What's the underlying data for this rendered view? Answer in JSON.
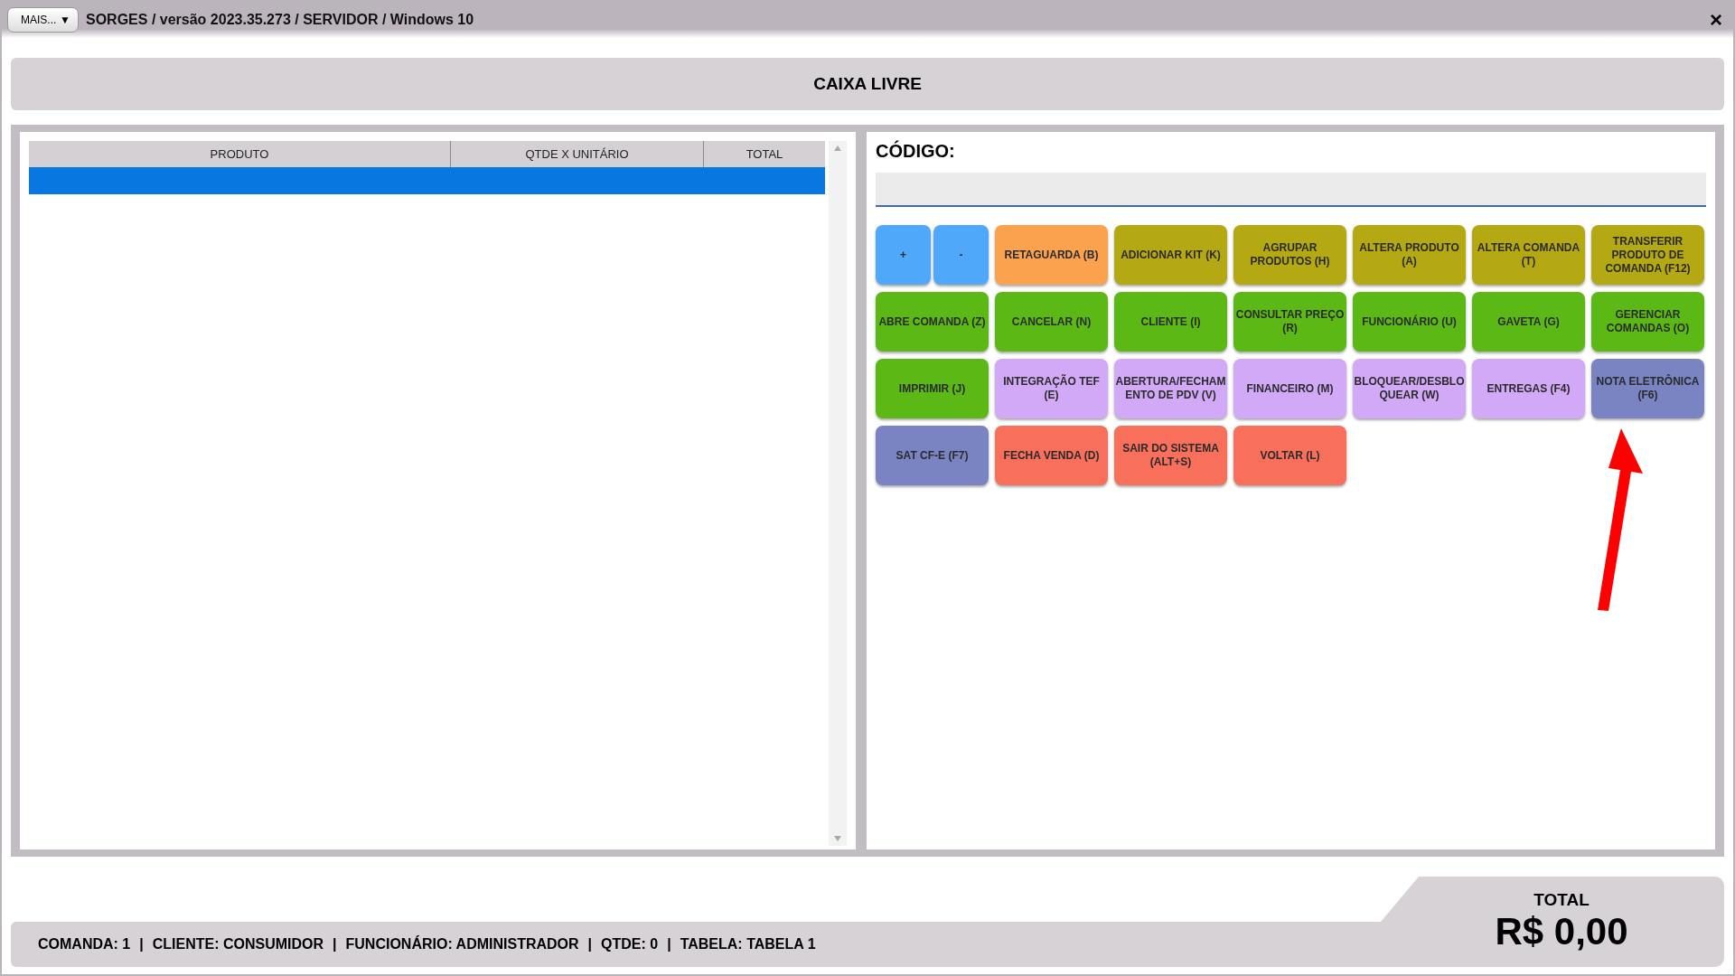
{
  "window": {
    "menu_button": "MAIS...",
    "menu_caret": "▼",
    "title": "SORGES / versão 2023.35.273 / SERVIDOR / Windows 10",
    "close": "×"
  },
  "header": {
    "title": "CAIXA LIVRE"
  },
  "table": {
    "columns": [
      "PRODUTO",
      "QTDE X UNITÁRIO",
      "TOTAL"
    ],
    "rows": [
      {
        "cells": [],
        "selected": true
      }
    ]
  },
  "code": {
    "label": "CÓDIGO:"
  },
  "buttons": [
    {
      "label": "+",
      "kind": "half",
      "color": "#4fa8fa"
    },
    {
      "label": "-",
      "kind": "half",
      "color": "#4fa8fa"
    },
    {
      "label": "RETAGUARDA (B)",
      "kind": "full",
      "color": "#fba24e"
    },
    {
      "label": "ADICIONAR KIT (K)",
      "kind": "full",
      "color": "#b4a912"
    },
    {
      "label": "AGRUPAR PRODUTOS (H)",
      "kind": "full",
      "color": "#b4a912"
    },
    {
      "label": "ALTERA PRODUTO (A)",
      "kind": "full",
      "color": "#b4a912"
    },
    {
      "label": "ALTERA COMANDA (T)",
      "kind": "full",
      "color": "#b4a912"
    },
    {
      "label": "TRANSFERIR PRODUTO DE COMANDA (F12)",
      "kind": "full",
      "color": "#b4a912"
    },
    {
      "label": "ABRE COMANDA (Z)",
      "kind": "full",
      "color": "#5cb814"
    },
    {
      "label": "CANCELAR (N)",
      "kind": "full",
      "color": "#5cb814"
    },
    {
      "label": "CLIENTE (I)",
      "kind": "full",
      "color": "#5cb814"
    },
    {
      "label": "CONSULTAR PREÇO (R)",
      "kind": "full",
      "color": "#5cb814"
    },
    {
      "label": "FUNCIONÁRIO (U)",
      "kind": "full",
      "color": "#5cb814"
    },
    {
      "label": "GAVETA (G)",
      "kind": "full",
      "color": "#5cb814"
    },
    {
      "label": "GERENCIAR COMANDAS (O)",
      "kind": "full",
      "color": "#5cb814"
    },
    {
      "label": "IMPRIMIR (J)",
      "kind": "full",
      "color": "#5cb814"
    },
    {
      "label": "INTEGRAÇÃO TEF (E)",
      "kind": "full",
      "color": "#d2a9f7"
    },
    {
      "label": "ABERTURA/FECHAMENTO DE PDV (V)",
      "kind": "full",
      "color": "#d2a9f7"
    },
    {
      "label": "FINANCEIRO (M)",
      "kind": "full",
      "color": "#d2a9f7"
    },
    {
      "label": "BLOQUEAR/DESBLOQUEAR (W)",
      "kind": "full",
      "color": "#d2a9f7"
    },
    {
      "label": "ENTREGAS (F4)",
      "kind": "full",
      "color": "#d2a9f7"
    },
    {
      "label": "NOTA ELETRÔNICA (F6)",
      "kind": "full",
      "color": "#7b84c2"
    },
    {
      "label": "SAT CF-E (F7)",
      "kind": "full",
      "color": "#7b84c2"
    },
    {
      "label": "FECHA VENDA (D)",
      "kind": "full",
      "color": "#f8705c"
    },
    {
      "label": "SAIR DO SISTEMA (ALT+S)",
      "kind": "full",
      "color": "#f8705c"
    },
    {
      "label": "VOLTAR (L)",
      "kind": "full",
      "color": "#f8705c"
    }
  ],
  "status_bar": {
    "items": [
      "COMANDA: 1",
      "CLIENTE: CONSUMIDOR",
      "FUNCIONÁRIO: ADMINISTRADOR",
      "QTDE: 0",
      "TABELA: TABELA 1"
    ],
    "separator": "|"
  },
  "total": {
    "label": "TOTAL",
    "value": "R$ 0,00"
  }
}
